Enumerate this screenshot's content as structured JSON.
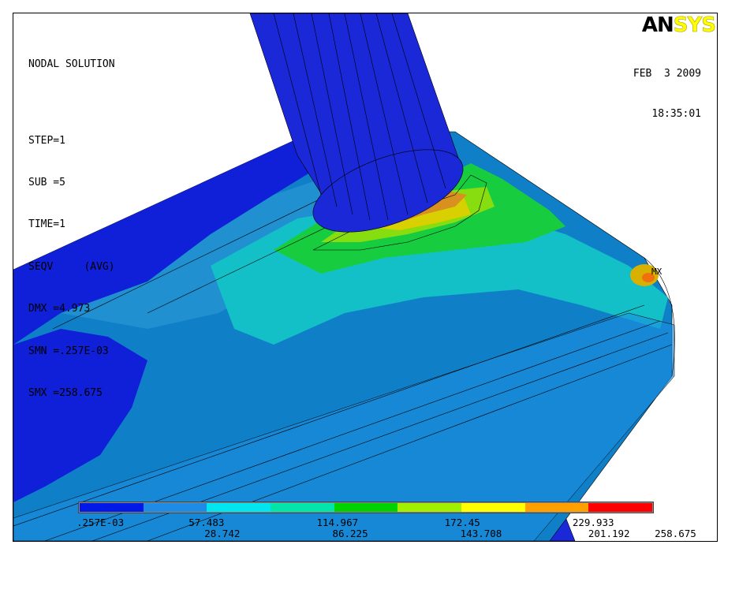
{
  "header": {
    "title": "NODAL SOLUTION",
    "step": "STEP=1",
    "sub": "SUB =5",
    "time": "TIME=1",
    "quantity": "SEQV     (AVG)",
    "dmx": "DMX =4.973",
    "smn": "SMN =.257E-03",
    "smx": "SMX =258.675"
  },
  "logo": {
    "part1": "AN",
    "part2": "SYS"
  },
  "date": "FEB  3 2009",
  "time_of_day": "18:35:01",
  "max_marker": "MX",
  "legend": {
    "colors": [
      "#0019e6",
      "#1e8ce6",
      "#00e6f0",
      "#00e6aa",
      "#00d200",
      "#a0f000",
      "#ffff00",
      "#ffa000",
      "#ff0000"
    ],
    "bottom_labels": [
      ".257E-03",
      "28.742",
      "86.225",
      "143.708",
      "201.192",
      "258.675"
    ],
    "top_labels": [
      "57.483",
      "114.967",
      "172.45",
      "229.933"
    ]
  }
}
